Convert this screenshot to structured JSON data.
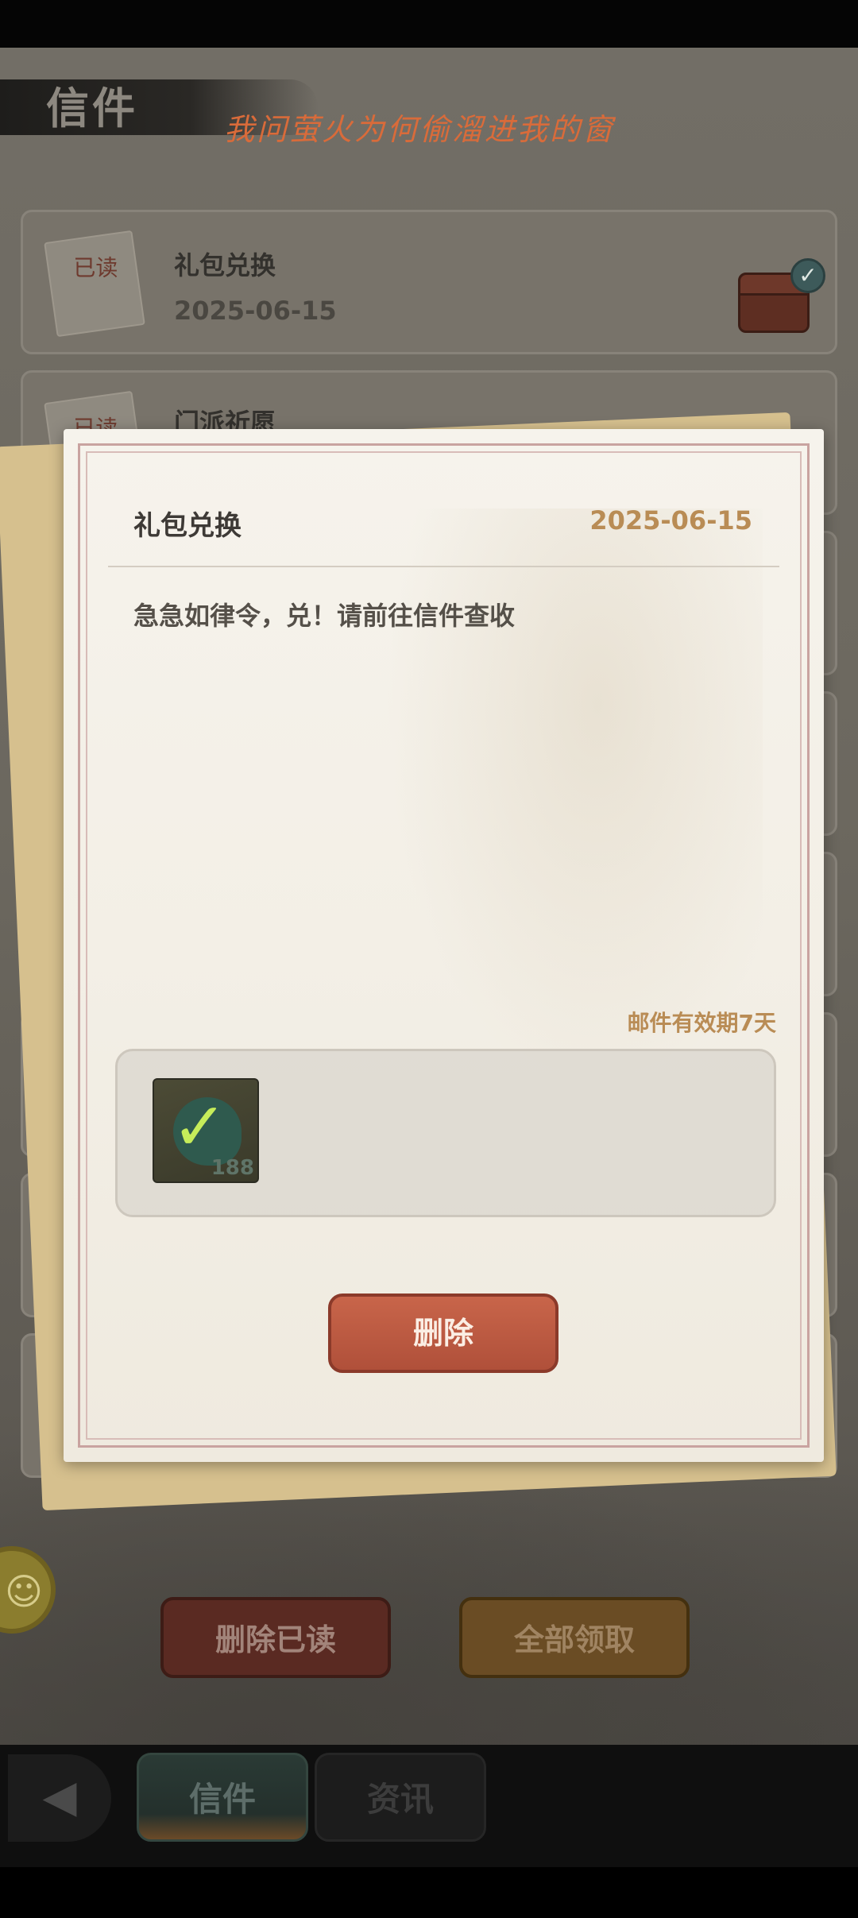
{
  "header": {
    "title": "信件",
    "marquee": "我问萤火为何偷溜进我的窗"
  },
  "mail_list": [
    {
      "title": "礼包兑换",
      "date": "2025-06-15",
      "badge": "已读",
      "claimed": true
    },
    {
      "title": "门派祈愿",
      "date": "",
      "badge": "已读",
      "claimed": false
    }
  ],
  "modal": {
    "title": "礼包兑换",
    "date": "2025-06-15",
    "body": "急急如律令，兑！请前往信件查收",
    "expiry": "邮件有效期7天",
    "attachments": [
      {
        "icon": "jade-token-icon",
        "quantity": "188",
        "claimed": true
      }
    ],
    "delete_label": "删除"
  },
  "actions": {
    "delete_read_label": "删除已读",
    "claim_all_label": "全部领取"
  },
  "tabs": [
    {
      "label": "信件",
      "active": true
    },
    {
      "label": "资讯",
      "active": false
    }
  ],
  "icons": {
    "back": "back-arrow-icon",
    "check": "check-icon",
    "side": "bubble-icon"
  },
  "colors": {
    "accent_orange": "#d96b3a",
    "date_gold": "#b98c55",
    "delete_red": "#b0503a"
  }
}
